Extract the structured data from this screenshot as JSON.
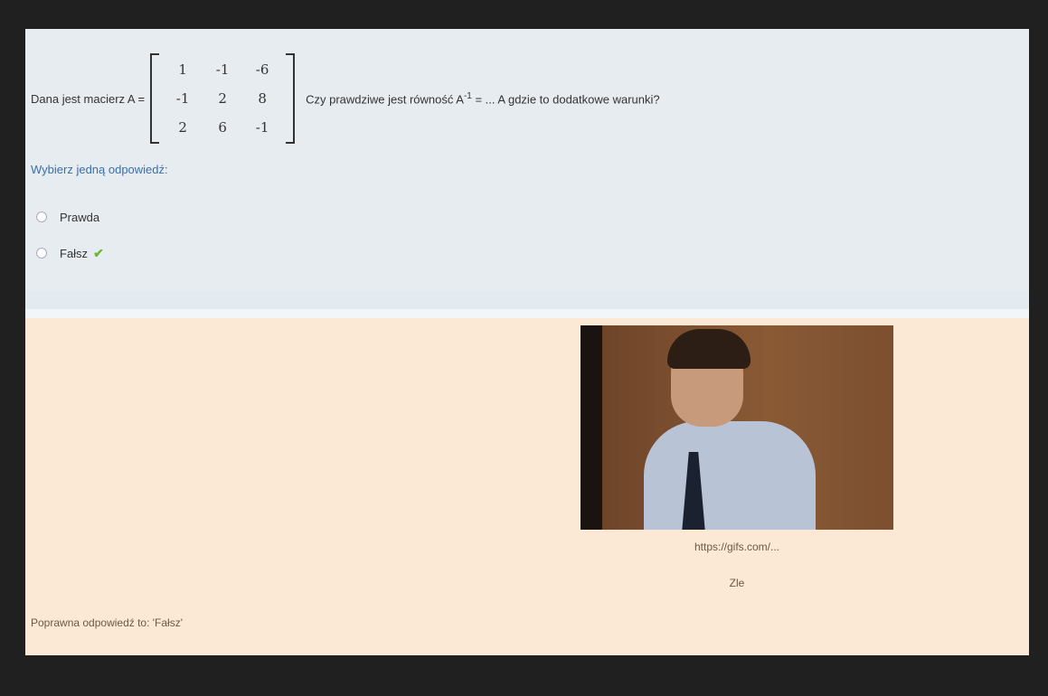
{
  "question": {
    "text_before": "Dana jest macierz A =",
    "matrix": [
      [
        "1",
        "-1",
        "-6"
      ],
      [
        "-1",
        "2",
        "8"
      ],
      [
        "2",
        "6",
        "-1"
      ]
    ],
    "text_after": "Czy prawdziwe jest równość A",
    "superscript": "-1",
    "text_tail": "= ... A gdzie to dodatkowe warunki?",
    "prompt": "Wybierz jedną odpowiedź:",
    "answers": [
      {
        "label": "Prawda",
        "correct": false
      },
      {
        "label": "Fałsz",
        "correct": true
      }
    ],
    "check_icon": "check-icon"
  },
  "feedback": {
    "gif_caption": "https://gifs.com/...",
    "gif_subcaption": "Zle",
    "correct_answer_text": "Poprawna odpowiedź to: 'Fałsz'"
  }
}
